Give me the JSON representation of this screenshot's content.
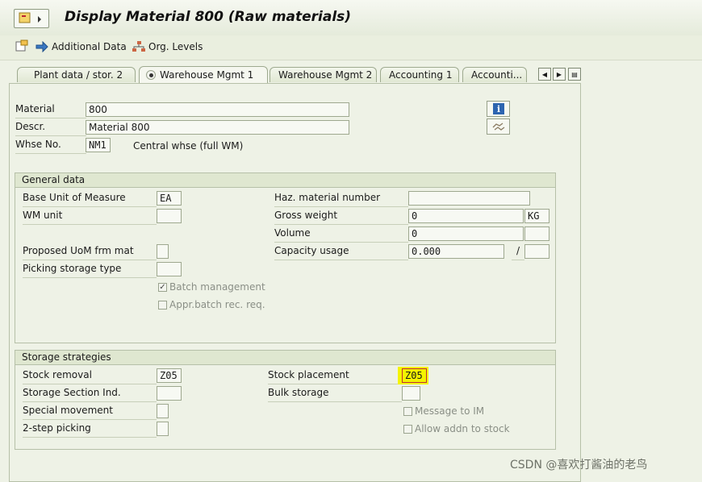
{
  "title": "Display Material 800 (Raw materials)",
  "toolbar": {
    "additional_data": "Additional Data",
    "org_levels": "Org. Levels"
  },
  "tabs": [
    "Plant data / stor. 2",
    "Warehouse Mgmt 1",
    "Warehouse Mgmt 2",
    "Accounting 1",
    "Accounti..."
  ],
  "header": {
    "material_label": "Material",
    "material_value": "800",
    "descr_label": "Descr.",
    "descr_value": "Material 800",
    "whse_label": "Whse No.",
    "whse_value": "NM1",
    "whse_text": "Central whse (full WM)"
  },
  "general": {
    "heading": "General data",
    "base_uom_label": "Base Unit of Measure",
    "base_uom_value": "EA",
    "wm_unit_label": "WM unit",
    "prop_uom_label": "Proposed UoM frm mat",
    "picking_label": "Picking storage type",
    "batch_mgmt_label": "Batch management",
    "appr_batch_label": "Appr.batch rec. req.",
    "haz_label": "Haz. material number",
    "gross_label": "Gross weight",
    "gross_value": "0",
    "gross_unit": "KG",
    "volume_label": "Volume",
    "volume_value": "0",
    "capacity_label": "Capacity usage",
    "capacity_value": "0.000",
    "capacity_sep": "/"
  },
  "strategies": {
    "heading": "Storage strategies",
    "removal_label": "Stock removal",
    "removal_value": "Z05",
    "section_label": "Storage Section Ind.",
    "special_label": "Special movement",
    "twostep_label": "2-step picking",
    "placement_label": "Stock placement",
    "placement_value": "Z05",
    "bulk_label": "Bulk storage",
    "msg_im_label": "Message to IM",
    "allow_addn_label": "Allow addn to stock"
  },
  "watermark": "CSDN @喜欢打酱油的老鸟",
  "colors": {
    "highlight": "#f4f400",
    "accent": "#1f5fa8"
  }
}
